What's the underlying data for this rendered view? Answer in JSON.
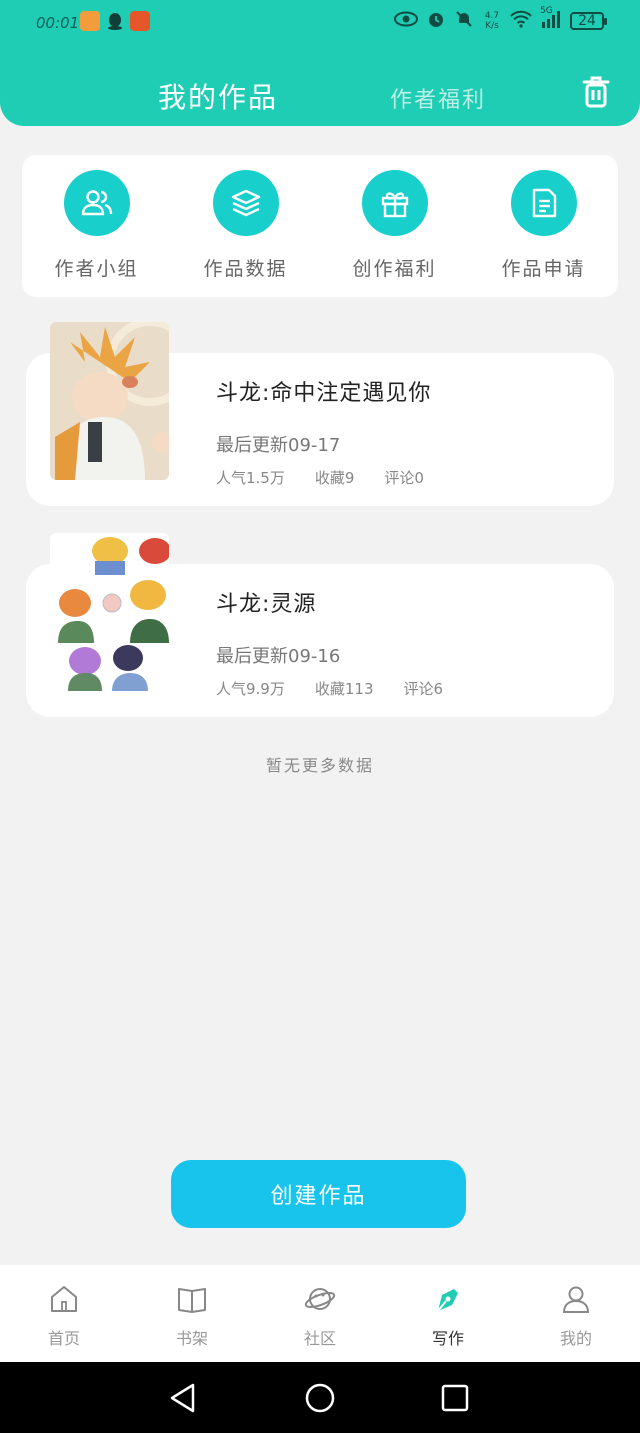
{
  "status_bar": {
    "time": "00:01",
    "network_speed_value": "4.7",
    "network_speed_unit": "K/s",
    "signal": "5G",
    "battery": "24"
  },
  "header": {
    "active_tab": "我的作品",
    "inactive_tab": "作者福利"
  },
  "quick_actions": [
    {
      "label": "作者小组",
      "icon": "group-icon"
    },
    {
      "label": "作品数据",
      "icon": "layers-icon"
    },
    {
      "label": "创作福利",
      "icon": "gift-icon"
    },
    {
      "label": "作品申请",
      "icon": "document-icon"
    }
  ],
  "works": [
    {
      "title": "斗龙:命中注定遇见你",
      "updated": "最后更新09-17",
      "popularity": "人气1.5万",
      "favorites": "收藏9",
      "comments": "评论0"
    },
    {
      "title": "斗龙:灵源",
      "updated": "最后更新09-16",
      "popularity": "人气9.9万",
      "favorites": "收藏113",
      "comments": "评论6"
    }
  ],
  "no_more_text": "暂无更多数据",
  "create_button": "创建作品",
  "bottom_nav": [
    {
      "label": "首页",
      "icon": "home-icon"
    },
    {
      "label": "书架",
      "icon": "book-icon"
    },
    {
      "label": "社区",
      "icon": "planet-icon"
    },
    {
      "label": "写作",
      "icon": "pen-icon"
    },
    {
      "label": "我的",
      "icon": "profile-icon"
    }
  ],
  "colors": {
    "brand": "#1fcdb4",
    "accent": "#18cfcc",
    "button": "#18c4ec"
  }
}
